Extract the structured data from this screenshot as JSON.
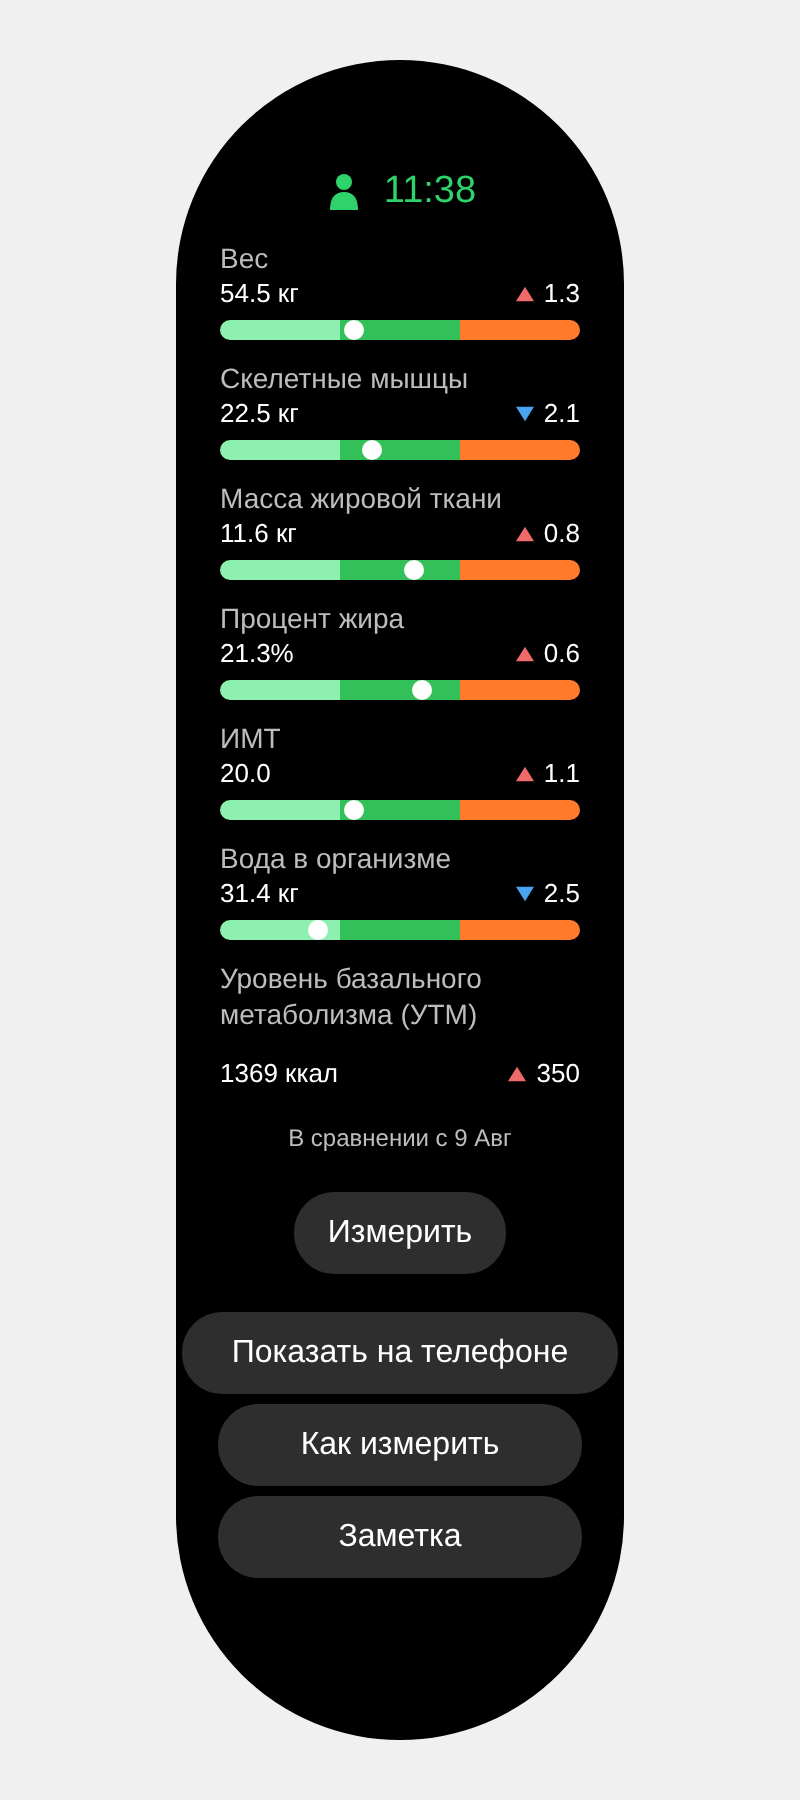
{
  "status": {
    "time": "11:38"
  },
  "metrics": [
    {
      "name": "Вес",
      "value": "54.5 кг",
      "kind": "increase",
      "change": "1.3",
      "level": 0.37
    },
    {
      "name": "Скелетные мышцы",
      "value": "22.5 кг",
      "kind": "decrease",
      "change": "2.1",
      "level": 0.42
    },
    {
      "name": "Масса жировой ткани",
      "value": "11.6 кг",
      "kind": "increase",
      "change": "0.8",
      "level": 0.54
    },
    {
      "name": "Процент жира",
      "value": "21.3%",
      "kind": "increase",
      "change": "0.6",
      "level": 0.56
    },
    {
      "name": "ИМТ",
      "value": "20.0",
      "kind": "increase",
      "change": "1.1",
      "level": 0.37
    },
    {
      "name": "Вода в организме",
      "value": "31.4 кг",
      "kind": "decrease",
      "change": "2.5",
      "level": 0.27
    },
    {
      "name": "Уровень базального метаболизма (УТМ)",
      "value": "1369 ккал",
      "kind": "increase",
      "change": "350"
    }
  ],
  "comparison": "В сравнении с 9 Авг",
  "buttons": [
    {
      "label": "Измерить",
      "kind": "small"
    },
    {
      "label": "Показать на телефоне",
      "kind": "wide"
    },
    {
      "label": "Как измерить",
      "kind": "normal"
    },
    {
      "label": "Заметка",
      "kind": "normal"
    }
  ]
}
